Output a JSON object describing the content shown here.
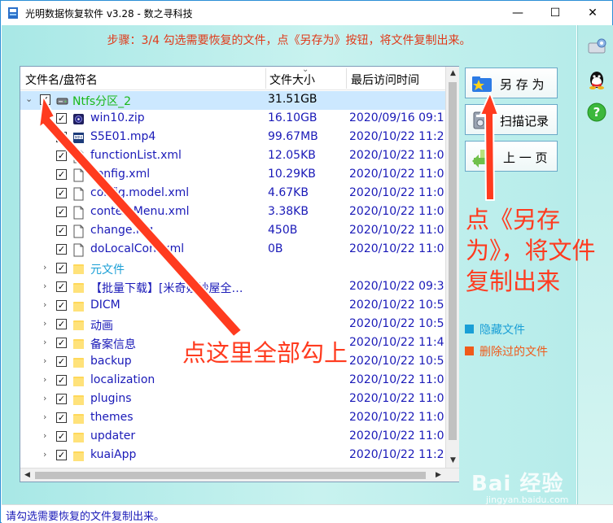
{
  "window": {
    "title": "光明数据恢复软件 v3.28 - 数之寻科技",
    "minimize_glyph": "—",
    "maximize_glyph": "☐",
    "close_glyph": "✕"
  },
  "step_text": "步骤：3/4 勾选需要恢复的文件，点《另存为》按钮，将文件复制出来。",
  "table": {
    "columns": [
      "文件名/盘符名",
      "文件大小",
      "最后访问时间"
    ],
    "sort_glyph": "⌄",
    "rows": [
      {
        "expander": "⌄",
        "check": "✓",
        "icon": "drive",
        "name": "Ntfs分区_2",
        "size": "31.51GB",
        "date": "",
        "style": "drive",
        "selected": true
      },
      {
        "expander": "",
        "check": "✓",
        "icon": "zip",
        "name": "win10.zip",
        "size": "16.10GB",
        "date": "2020/09/16 09:1",
        "style": "file",
        "selected": false
      },
      {
        "expander": "",
        "check": "✓",
        "icon": "video",
        "name": "S5E01.mp4",
        "size": "99.67MB",
        "date": "2020/10/22 11:2",
        "style": "file",
        "selected": false
      },
      {
        "expander": "",
        "check": "✓",
        "icon": "doc",
        "name": "functionList.xml",
        "size": "12.05KB",
        "date": "2020/10/22 11:0",
        "style": "file",
        "selected": false
      },
      {
        "expander": "",
        "check": "✓",
        "icon": "doc",
        "name": "config.xml",
        "size": "10.29KB",
        "date": "2020/10/22 11:0",
        "style": "file",
        "selected": false
      },
      {
        "expander": "",
        "check": "✓",
        "icon": "doc",
        "name": "config.model.xml",
        "size": "4.67KB",
        "date": "2020/10/22 11:0",
        "style": "file",
        "selected": false
      },
      {
        "expander": "",
        "check": "✓",
        "icon": "doc",
        "name": "contextMenu.xml",
        "size": "3.38KB",
        "date": "2020/10/22 11:0",
        "style": "file",
        "selected": false
      },
      {
        "expander": "",
        "check": "✓",
        "icon": "doc",
        "name": "change.log",
        "size": "450B",
        "date": "2020/10/22 11:0",
        "style": "file",
        "selected": false
      },
      {
        "expander": "",
        "check": "✓",
        "icon": "doc",
        "name": "doLocalConf.xml",
        "size": "0B",
        "date": "2020/10/22 11:0",
        "style": "file",
        "selected": false
      },
      {
        "expander": "›",
        "check": "✓",
        "icon": "folder",
        "name": "元文件",
        "size": "",
        "date": "",
        "style": "meta",
        "selected": false
      },
      {
        "expander": "›",
        "check": "✓",
        "icon": "folder",
        "name": "【批量下载】[米奇妙妙屋全…",
        "size": "",
        "date": "2020/10/22 09:3",
        "style": "file",
        "selected": false
      },
      {
        "expander": "›",
        "check": "✓",
        "icon": "folder",
        "name": "DICM",
        "size": "",
        "date": "2020/10/22 10:5",
        "style": "file",
        "selected": false
      },
      {
        "expander": "›",
        "check": "✓",
        "icon": "folder",
        "name": "动画",
        "size": "",
        "date": "2020/10/22 10:5",
        "style": "file",
        "selected": false
      },
      {
        "expander": "›",
        "check": "✓",
        "icon": "folder",
        "name": "备案信息",
        "size": "",
        "date": "2020/10/22 11:4",
        "style": "file",
        "selected": false
      },
      {
        "expander": "›",
        "check": "✓",
        "icon": "folder",
        "name": "backup",
        "size": "",
        "date": "2020/10/22 10:5",
        "style": "file",
        "selected": false
      },
      {
        "expander": "›",
        "check": "✓",
        "icon": "folder",
        "name": "localization",
        "size": "",
        "date": "2020/10/22 11:0",
        "style": "file",
        "selected": false
      },
      {
        "expander": "›",
        "check": "✓",
        "icon": "folder",
        "name": "plugins",
        "size": "",
        "date": "2020/10/22 11:0",
        "style": "file",
        "selected": false
      },
      {
        "expander": "›",
        "check": "✓",
        "icon": "folder",
        "name": "themes",
        "size": "",
        "date": "2020/10/22 11:0",
        "style": "file",
        "selected": false
      },
      {
        "expander": "›",
        "check": "✓",
        "icon": "folder",
        "name": "updater",
        "size": "",
        "date": "2020/10/22 11:0",
        "style": "file",
        "selected": false
      },
      {
        "expander": "›",
        "check": "✓",
        "icon": "folder",
        "name": "kuaiApp",
        "size": "",
        "date": "2020/10/22 11:2",
        "style": "file",
        "selected": false
      }
    ]
  },
  "buttons": {
    "save_as": "另 存 为",
    "scan_record": "扫描记录",
    "prev_page": "上 一 页"
  },
  "legend": {
    "hidden": {
      "label": "隐藏文件",
      "color": "#1a9fd6"
    },
    "deleted": {
      "label": "删除过的文件",
      "color": "#f05a1a"
    }
  },
  "annotations": {
    "check_all": "点这里全部勾上",
    "save_line1": "点《另存",
    "save_line2": "为》，将文件",
    "save_line3": "复制出来"
  },
  "status": "请勾选需要恢复的文件复制出来。",
  "watermark": {
    "brand": "Bai 经验",
    "url": "jingyan.baidu.com"
  },
  "colors": {
    "accent_red": "#ff3b1f",
    "file_text": "#1a1ab8",
    "drive_text": "#18b818",
    "meta_text": "#1a9fd6"
  }
}
